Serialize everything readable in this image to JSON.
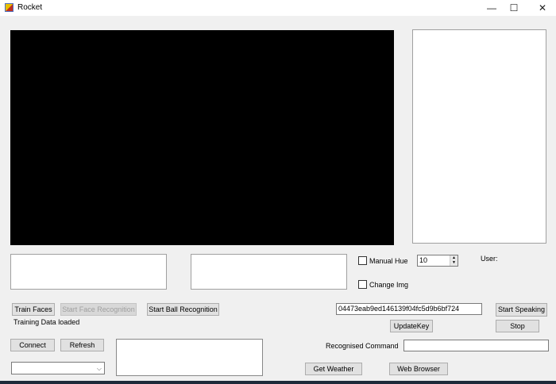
{
  "window": {
    "title": "Rocket",
    "minimize": "—",
    "maximize": "☐",
    "close": "✕"
  },
  "vision": {
    "manual_hue_label": "Manual Hue",
    "hue_value": "10",
    "change_img_label": "Change Img",
    "user_label": "User:"
  },
  "buttons": {
    "train_faces": "Train Faces",
    "start_face": "Start Face Recognition",
    "start_ball": "Start Ball Recognition",
    "connect": "Connect",
    "refresh": "Refresh",
    "start_speaking": "Start Speaking",
    "stop": "Stop",
    "update_key": "UpdateKey",
    "get_weather": "Get Weather",
    "web_browser": "Web Browser"
  },
  "status": {
    "training": "Training Data loaded"
  },
  "speech": {
    "api_key": "04473eab9ed146139f04fc5d9b6bf724",
    "recognised_label": "Recognised Command",
    "recognised_value": ""
  }
}
